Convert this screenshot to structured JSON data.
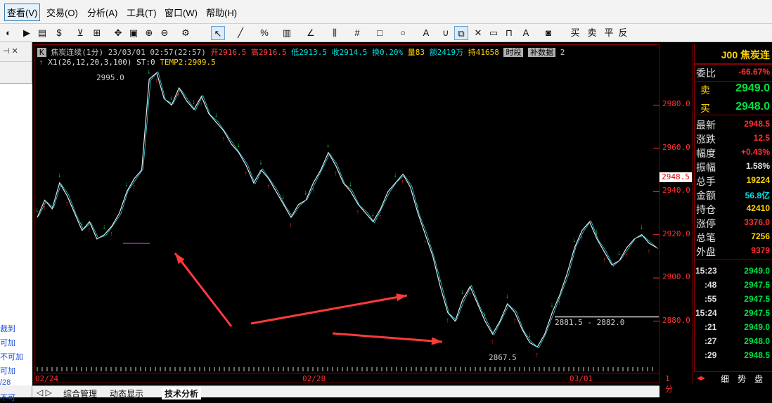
{
  "menu": [
    "查看(V)",
    "交易(O)",
    "分析(A)",
    "工具(T)",
    "窗口(W)",
    "帮助(H)"
  ],
  "toolbar": {
    "buy": "买",
    "sell": "卖",
    "flat": "平",
    "reverse": "反"
  },
  "left_panel": {
    "items": [
      "裁到",
      "可加",
      "不可加",
      "可加",
      "/28",
      "不可"
    ]
  },
  "chart": {
    "info": {
      "k_badge": "K",
      "symbol": "焦炭连续(1分)",
      "datetime": "23/03/01 02:57(22:57)",
      "open": "开2916.5",
      "high": "高2916.5",
      "low": "低2913.5",
      "close": "收2914.5",
      "turnover": "换0.20%",
      "volume": "量83",
      "amount": "额2419万",
      "position": "持41658",
      "btn_period": "时段",
      "btn_data": "补数据",
      "page": "2"
    },
    "indicator": {
      "name": "X1(26,12,20,3,100)",
      "st": "ST:0",
      "temp": "TEMP2:2909.5"
    },
    "labels": {
      "high_mark": "2995.0",
      "low_mark": "2867.5",
      "range_mark": "2881.5 - 2882.0"
    },
    "yticks": [
      "2980.0",
      "2960.0",
      "2940.0",
      "2920.0",
      "2900.0",
      "2880.0"
    ],
    "current_price": "2948.5",
    "xticks": [
      "02/24",
      "02/28",
      "03/01",
      "1分"
    ]
  },
  "chart_data": {
    "type": "line",
    "title": "焦炭连续(1分)",
    "series": [
      {
        "name": "焦炭连续",
        "values": [
          2928,
          2936,
          2932,
          2944,
          2938,
          2930,
          2922,
          2926,
          2918,
          2920,
          2924,
          2930,
          2940,
          2946,
          2950,
          2992,
          2995,
          2983,
          2980,
          2988,
          2982,
          2978,
          2984,
          2976,
          2972,
          2968,
          2962,
          2958,
          2952,
          2944,
          2950,
          2946,
          2940,
          2934,
          2928,
          2934,
          2936,
          2944,
          2950,
          2958,
          2952,
          2944,
          2940,
          2934,
          2930,
          2926,
          2932,
          2940,
          2944,
          2948,
          2942,
          2930,
          2920,
          2910,
          2896,
          2884,
          2880,
          2890,
          2896,
          2888,
          2880,
          2874,
          2880,
          2888,
          2884,
          2876,
          2870,
          2868,
          2874,
          2884,
          2892,
          2902,
          2914,
          2922,
          2926,
          2918,
          2912,
          2906,
          2908,
          2914,
          2918,
          2920,
          2916,
          2914
        ]
      }
    ],
    "ylim": [
      2860,
      3000
    ],
    "xlabel": "",
    "ylabel": ""
  },
  "quote": {
    "code": "J00",
    "name": "焦炭连",
    "rows": [
      {
        "label": "委比",
        "value": "-66.67%",
        "color": "#ff3030"
      },
      {
        "label": "卖",
        "value": "2949.0",
        "color": "#00e040"
      },
      {
        "label": "买",
        "value": "2948.0",
        "color": "#00e040"
      },
      {
        "label": "最新",
        "value": "2948.5",
        "color": "#ff3030"
      },
      {
        "label": "涨跌",
        "value": "12.5",
        "color": "#ff3030"
      },
      {
        "label": "幅度",
        "value": "+0.43%",
        "color": "#ff3030"
      },
      {
        "label": "振幅",
        "value": "1.58%",
        "color": "#e0e0e0"
      },
      {
        "label": "总手",
        "value": "19224",
        "color": "#ffd400"
      },
      {
        "label": "金额",
        "value": "56.8亿",
        "color": "#00e0e0"
      },
      {
        "label": "持仓",
        "value": "42410",
        "color": "#ffd400"
      },
      {
        "label": "涨停",
        "value": "3376.0",
        "color": "#ff3030"
      },
      {
        "label": "总笔",
        "value": "7256",
        "color": "#ffd400"
      },
      {
        "label": "外盘",
        "value": "9379",
        "color": "#ff3030"
      }
    ],
    "ticks": [
      {
        "time": "15:23",
        "price": "2949.0"
      },
      {
        "time": ":48",
        "price": "2947.5"
      },
      {
        "time": ":55",
        "price": "2947.5"
      },
      {
        "time": "15:24",
        "price": "2947.5"
      },
      {
        "time": ":21",
        "price": "2949.0"
      },
      {
        "time": ":27",
        "price": "2948.0"
      },
      {
        "time": ":29",
        "price": "2948.5"
      }
    ],
    "tabs": [
      "细",
      "势",
      "盘"
    ]
  },
  "bottom_tabs": [
    "综合管理",
    "动态显示",
    "技术分析"
  ]
}
